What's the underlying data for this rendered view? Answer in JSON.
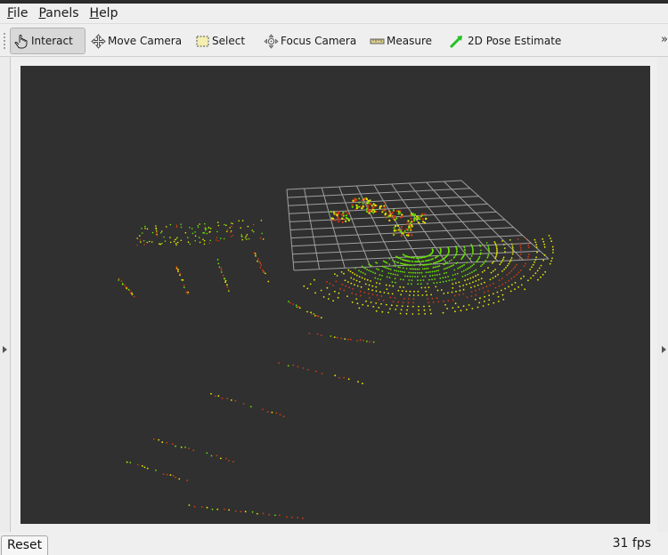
{
  "menu": [
    {
      "mnemonic": "F",
      "rest": "ile"
    },
    {
      "mnemonic": "P",
      "rest": "anels"
    },
    {
      "mnemonic": "H",
      "rest": "elp"
    }
  ],
  "toolbar": {
    "interact": "Interact",
    "move_camera": "Move Camera",
    "select": "Select",
    "focus_camera": "Focus Camera",
    "measure": "Measure",
    "pose_estimate": "2D Pose Estimate",
    "overflow": "»"
  },
  "status": {
    "reset_label": "Reset",
    "fps": "31 fps"
  },
  "colors": {
    "viewport_bg": "#303030",
    "grid": "#a0a0a0",
    "points_green": "#66e000",
    "points_yellow": "#e8e800",
    "points_red": "#d43a12"
  }
}
